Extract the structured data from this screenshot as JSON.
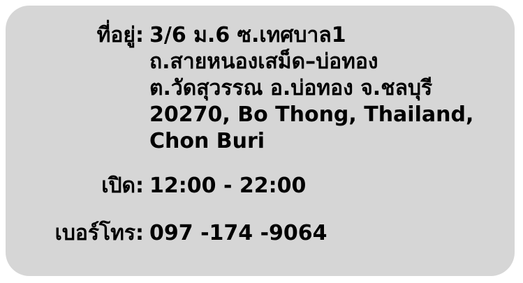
{
  "info": {
    "address_label": "ที่อยู่:",
    "address_lines": [
      "3/6 ม.6 ซ.เทศบาล1",
      "ถ.สายหนองเสม็ด–บ่อทอง",
      "ต.วัดสุวรรณ อ.บ่อทอง จ.ชลบุรี",
      "20270, Bo Thong, Thailand,",
      "Chon Buri"
    ],
    "hours_label": "เปิด:",
    "hours_value": "12:00 - 22:00",
    "phone_label": "เบอร์โทร:",
    "phone_value": "097 -174 -9064"
  },
  "colors": {
    "card_background": "#d6d6d6",
    "text": "#000000"
  }
}
